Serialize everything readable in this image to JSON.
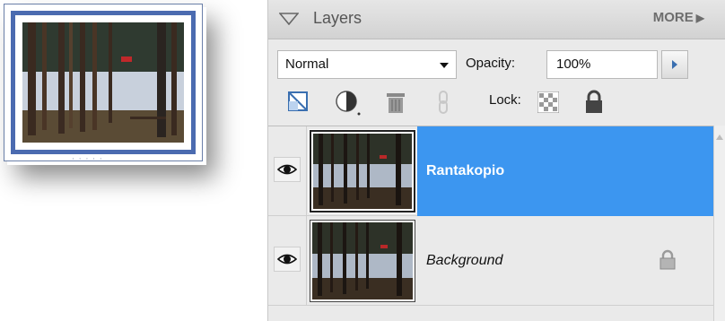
{
  "panel": {
    "title": "Layers",
    "more_label": "MORE"
  },
  "controls": {
    "blend_mode": "Normal",
    "opacity_label": "Opacity:",
    "opacity_value": "100%",
    "lock_label": "Lock:"
  },
  "layers": [
    {
      "name": "Rantakopio",
      "visible": true,
      "selected": true,
      "locked": false
    },
    {
      "name": "Background",
      "visible": true,
      "selected": false,
      "locked": true
    }
  ],
  "icons": {
    "collapse": "triangle-down-icon",
    "more": "triangle-right-icon",
    "new_layer": "new-layer-icon",
    "adjustment": "half-circle-icon",
    "delete": "trash-icon",
    "link": "chain-link-icon",
    "lock_transparent": "checkerboard-icon",
    "lock_all": "padlock-icon",
    "visibility": "eye-icon"
  },
  "colors": {
    "selection": "#3c96f0",
    "thumb_border": "#4b6bb0"
  }
}
